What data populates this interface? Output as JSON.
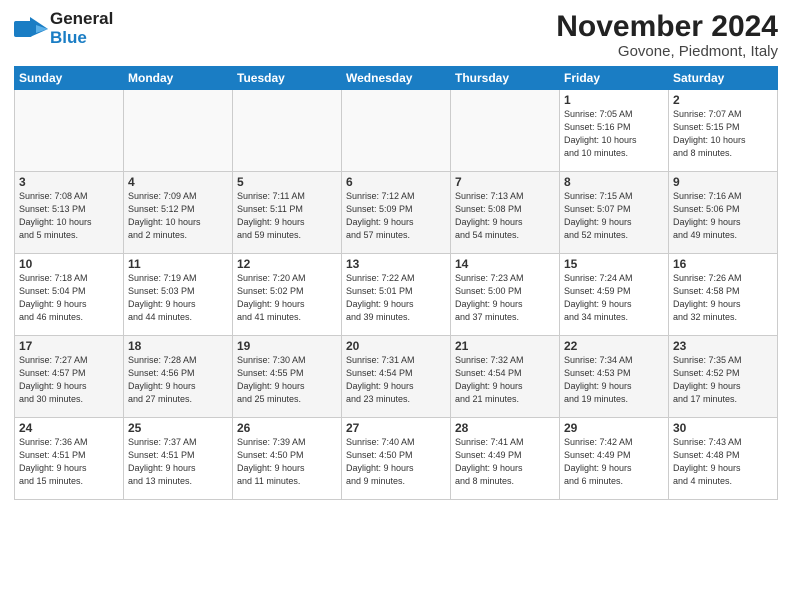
{
  "logo": {
    "line1": "General",
    "line2": "Blue"
  },
  "header": {
    "month": "November 2024",
    "location": "Govone, Piedmont, Italy"
  },
  "weekdays": [
    "Sunday",
    "Monday",
    "Tuesday",
    "Wednesday",
    "Thursday",
    "Friday",
    "Saturday"
  ],
  "weeks": [
    [
      {
        "day": "",
        "info": ""
      },
      {
        "day": "",
        "info": ""
      },
      {
        "day": "",
        "info": ""
      },
      {
        "day": "",
        "info": ""
      },
      {
        "day": "",
        "info": ""
      },
      {
        "day": "1",
        "info": "Sunrise: 7:05 AM\nSunset: 5:16 PM\nDaylight: 10 hours\nand 10 minutes."
      },
      {
        "day": "2",
        "info": "Sunrise: 7:07 AM\nSunset: 5:15 PM\nDaylight: 10 hours\nand 8 minutes."
      }
    ],
    [
      {
        "day": "3",
        "info": "Sunrise: 7:08 AM\nSunset: 5:13 PM\nDaylight: 10 hours\nand 5 minutes."
      },
      {
        "day": "4",
        "info": "Sunrise: 7:09 AM\nSunset: 5:12 PM\nDaylight: 10 hours\nand 2 minutes."
      },
      {
        "day": "5",
        "info": "Sunrise: 7:11 AM\nSunset: 5:11 PM\nDaylight: 9 hours\nand 59 minutes."
      },
      {
        "day": "6",
        "info": "Sunrise: 7:12 AM\nSunset: 5:09 PM\nDaylight: 9 hours\nand 57 minutes."
      },
      {
        "day": "7",
        "info": "Sunrise: 7:13 AM\nSunset: 5:08 PM\nDaylight: 9 hours\nand 54 minutes."
      },
      {
        "day": "8",
        "info": "Sunrise: 7:15 AM\nSunset: 5:07 PM\nDaylight: 9 hours\nand 52 minutes."
      },
      {
        "day": "9",
        "info": "Sunrise: 7:16 AM\nSunset: 5:06 PM\nDaylight: 9 hours\nand 49 minutes."
      }
    ],
    [
      {
        "day": "10",
        "info": "Sunrise: 7:18 AM\nSunset: 5:04 PM\nDaylight: 9 hours\nand 46 minutes."
      },
      {
        "day": "11",
        "info": "Sunrise: 7:19 AM\nSunset: 5:03 PM\nDaylight: 9 hours\nand 44 minutes."
      },
      {
        "day": "12",
        "info": "Sunrise: 7:20 AM\nSunset: 5:02 PM\nDaylight: 9 hours\nand 41 minutes."
      },
      {
        "day": "13",
        "info": "Sunrise: 7:22 AM\nSunset: 5:01 PM\nDaylight: 9 hours\nand 39 minutes."
      },
      {
        "day": "14",
        "info": "Sunrise: 7:23 AM\nSunset: 5:00 PM\nDaylight: 9 hours\nand 37 minutes."
      },
      {
        "day": "15",
        "info": "Sunrise: 7:24 AM\nSunset: 4:59 PM\nDaylight: 9 hours\nand 34 minutes."
      },
      {
        "day": "16",
        "info": "Sunrise: 7:26 AM\nSunset: 4:58 PM\nDaylight: 9 hours\nand 32 minutes."
      }
    ],
    [
      {
        "day": "17",
        "info": "Sunrise: 7:27 AM\nSunset: 4:57 PM\nDaylight: 9 hours\nand 30 minutes."
      },
      {
        "day": "18",
        "info": "Sunrise: 7:28 AM\nSunset: 4:56 PM\nDaylight: 9 hours\nand 27 minutes."
      },
      {
        "day": "19",
        "info": "Sunrise: 7:30 AM\nSunset: 4:55 PM\nDaylight: 9 hours\nand 25 minutes."
      },
      {
        "day": "20",
        "info": "Sunrise: 7:31 AM\nSunset: 4:54 PM\nDaylight: 9 hours\nand 23 minutes."
      },
      {
        "day": "21",
        "info": "Sunrise: 7:32 AM\nSunset: 4:54 PM\nDaylight: 9 hours\nand 21 minutes."
      },
      {
        "day": "22",
        "info": "Sunrise: 7:34 AM\nSunset: 4:53 PM\nDaylight: 9 hours\nand 19 minutes."
      },
      {
        "day": "23",
        "info": "Sunrise: 7:35 AM\nSunset: 4:52 PM\nDaylight: 9 hours\nand 17 minutes."
      }
    ],
    [
      {
        "day": "24",
        "info": "Sunrise: 7:36 AM\nSunset: 4:51 PM\nDaylight: 9 hours\nand 15 minutes."
      },
      {
        "day": "25",
        "info": "Sunrise: 7:37 AM\nSunset: 4:51 PM\nDaylight: 9 hours\nand 13 minutes."
      },
      {
        "day": "26",
        "info": "Sunrise: 7:39 AM\nSunset: 4:50 PM\nDaylight: 9 hours\nand 11 minutes."
      },
      {
        "day": "27",
        "info": "Sunrise: 7:40 AM\nSunset: 4:50 PM\nDaylight: 9 hours\nand 9 minutes."
      },
      {
        "day": "28",
        "info": "Sunrise: 7:41 AM\nSunset: 4:49 PM\nDaylight: 9 hours\nand 8 minutes."
      },
      {
        "day": "29",
        "info": "Sunrise: 7:42 AM\nSunset: 4:49 PM\nDaylight: 9 hours\nand 6 minutes."
      },
      {
        "day": "30",
        "info": "Sunrise: 7:43 AM\nSunset: 4:48 PM\nDaylight: 9 hours\nand 4 minutes."
      }
    ]
  ]
}
